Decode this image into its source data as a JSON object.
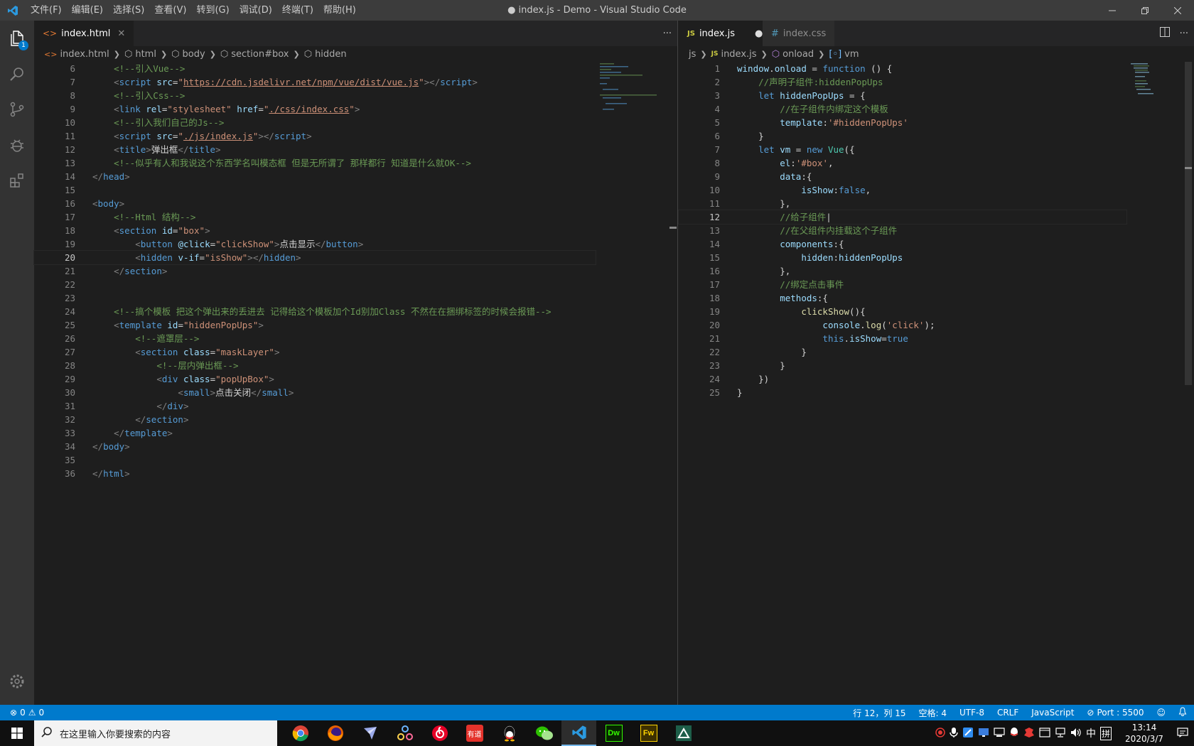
{
  "titlebar": {
    "menu": [
      "文件(F)",
      "编辑(E)",
      "选择(S)",
      "查看(V)",
      "转到(G)",
      "调试(D)",
      "终端(T)",
      "帮助(H)"
    ],
    "title": "● index.js - Demo - Visual Studio Code"
  },
  "activity": {
    "explorer_badge": "1"
  },
  "left_editor": {
    "tab_label": "index.html",
    "breadcrumbs": [
      "index.html",
      "html",
      "body",
      "section#box",
      "hidden"
    ],
    "lines": [
      {
        "n": "6",
        "html": "    <span class='cm'>&lt;!--引入Vue--&gt;</span>"
      },
      {
        "n": "7",
        "html": "    <span class='br'>&lt;</span><span class='tg'>script</span> <span class='at'>src</span><span class='tx'>=</span><span class='st'>\"<span class='ul'>https://cdn.jsdelivr.net/npm/vue/dist/vue.js</span>\"</span><span class='br'>&gt;&lt;/</span><span class='tg'>script</span><span class='br'>&gt;</span>"
      },
      {
        "n": "8",
        "html": "    <span class='cm'>&lt;!--引入Css--&gt;</span>"
      },
      {
        "n": "9",
        "html": "    <span class='br'>&lt;</span><span class='tg'>link</span> <span class='at'>rel</span><span class='tx'>=</span><span class='st'>\"stylesheet\"</span> <span class='at'>href</span><span class='tx'>=</span><span class='st'>\"<span class='ul'>./css/index.css</span>\"</span><span class='br'>&gt;</span>"
      },
      {
        "n": "10",
        "html": "    <span class='cm'>&lt;!--引入我们自己的Js--&gt;</span>"
      },
      {
        "n": "11",
        "html": "    <span class='br'>&lt;</span><span class='tg'>script</span> <span class='at'>src</span><span class='tx'>=</span><span class='st'>\"<span class='ul'>./js/index.js</span>\"</span><span class='br'>&gt;&lt;/</span><span class='tg'>script</span><span class='br'>&gt;</span>"
      },
      {
        "n": "12",
        "html": "    <span class='br'>&lt;</span><span class='tg'>title</span><span class='br'>&gt;</span><span class='tx'>弹出框</span><span class='br'>&lt;/</span><span class='tg'>title</span><span class='br'>&gt;</span>"
      },
      {
        "n": "13",
        "html": "    <span class='cm'>&lt;!--似乎有人和我说这个东西学名叫模态框 但是无所谓了 那样都行 知道是什么就OK--&gt;</span>"
      },
      {
        "n": "14",
        "html": "<span class='br'>&lt;/</span><span class='tg'>head</span><span class='br'>&gt;</span>"
      },
      {
        "n": "15",
        "html": ""
      },
      {
        "n": "16",
        "html": "<span class='br'>&lt;</span><span class='tg'>body</span><span class='br'>&gt;</span>"
      },
      {
        "n": "17",
        "html": "    <span class='cm'>&lt;!--Html 结构--&gt;</span>"
      },
      {
        "n": "18",
        "html": "    <span class='br'>&lt;</span><span class='tg'>section</span> <span class='at'>id</span><span class='tx'>=</span><span class='st'>\"box\"</span><span class='br'>&gt;</span>"
      },
      {
        "n": "19",
        "html": "        <span class='br'>&lt;</span><span class='tg'>button</span> <span class='at'>@click</span><span class='tx'>=</span><span class='st'>\"clickShow\"</span><span class='br'>&gt;</span><span class='tx'>点击显示</span><span class='br'>&lt;/</span><span class='tg'>button</span><span class='br'>&gt;</span>"
      },
      {
        "n": "20",
        "html": "        <span class='br'>&lt;</span><span class='tg'>hidden</span> <span class='at'>v-if</span><span class='tx'>=</span><span class='st'>\"isShow\"</span><span class='br'>&gt;&lt;/</span><span class='tg'>hidden</span><span class='br'>&gt;</span>",
        "current": true
      },
      {
        "n": "21",
        "html": "    <span class='br'>&lt;/</span><span class='tg'>section</span><span class='br'>&gt;</span>"
      },
      {
        "n": "22",
        "html": ""
      },
      {
        "n": "23",
        "html": ""
      },
      {
        "n": "24",
        "html": "    <span class='cm'>&lt;!--搞个模板 把这个弹出来的丢进去 记得给这个模板加个Id别加Class 不然在在捆绑标签的时候会报错--&gt;</span>"
      },
      {
        "n": "25",
        "html": "    <span class='br'>&lt;</span><span class='tg'>template</span> <span class='at'>id</span><span class='tx'>=</span><span class='st'>\"hiddenPopUps\"</span><span class='br'>&gt;</span>"
      },
      {
        "n": "26",
        "html": "        <span class='cm'>&lt;!--遮罩层--&gt;</span>"
      },
      {
        "n": "27",
        "html": "        <span class='br'>&lt;</span><span class='tg'>section</span> <span class='at'>class</span><span class='tx'>=</span><span class='st'>\"maskLayer\"</span><span class='br'>&gt;</span>"
      },
      {
        "n": "28",
        "html": "            <span class='cm'>&lt;!--层内弹出框--&gt;</span>"
      },
      {
        "n": "29",
        "html": "            <span class='br'>&lt;</span><span class='tg'>div</span> <span class='at'>class</span><span class='tx'>=</span><span class='st'>\"popUpBox\"</span><span class='br'>&gt;</span>"
      },
      {
        "n": "30",
        "html": "                <span class='br'>&lt;</span><span class='tg'>small</span><span class='br'>&gt;</span><span class='tx'>点击关闭</span><span class='br'>&lt;/</span><span class='tg'>small</span><span class='br'>&gt;</span>"
      },
      {
        "n": "31",
        "html": "            <span class='br'>&lt;/</span><span class='tg'>div</span><span class='br'>&gt;</span>"
      },
      {
        "n": "32",
        "html": "        <span class='br'>&lt;/</span><span class='tg'>section</span><span class='br'>&gt;</span>"
      },
      {
        "n": "33",
        "html": "    <span class='br'>&lt;/</span><span class='tg'>template</span><span class='br'>&gt;</span>"
      },
      {
        "n": "34",
        "html": "<span class='br'>&lt;/</span><span class='tg'>body</span><span class='br'>&gt;</span>"
      },
      {
        "n": "35",
        "html": ""
      },
      {
        "n": "36",
        "html": "<span class='br'>&lt;/</span><span class='tg'>html</span><span class='br'>&gt;</span>"
      }
    ]
  },
  "right_editor": {
    "tabs": [
      {
        "label": "index.js",
        "icon": "JS",
        "active": true,
        "modified": true
      },
      {
        "label": "index.css",
        "icon": "#",
        "active": false
      }
    ],
    "breadcrumbs": [
      "js",
      "index.js",
      "onload",
      "vm"
    ],
    "lines": [
      {
        "n": "1",
        "html": "<span class='vr'>window</span><span class='tx'>.</span><span class='vr'>onload</span><span class='tx'> = </span><span class='kw'>function</span><span class='tx'> () {</span>"
      },
      {
        "n": "2",
        "html": "    <span class='cm'>//声明子组件:hiddenPopUps</span>"
      },
      {
        "n": "3",
        "html": "    <span class='kw'>let</span> <span class='vr'>hiddenPopUps</span><span class='tx'> = {</span>"
      },
      {
        "n": "4",
        "html": "        <span class='cm'>//在子组件内绑定这个模板</span>"
      },
      {
        "n": "5",
        "html": "        <span class='vr'>template</span><span class='tx'>:</span><span class='st'>'#hiddenPopUps'</span>"
      },
      {
        "n": "6",
        "html": "    <span class='tx'>}</span>"
      },
      {
        "n": "7",
        "html": "    <span class='kw'>let</span> <span class='vr'>vm</span><span class='tx'> = </span><span class='kw'>new</span> <span class='cl'>Vue</span><span class='tx'>({</span>"
      },
      {
        "n": "8",
        "html": "        <span class='vr'>el</span><span class='tx'>:</span><span class='st'>'#box'</span><span class='tx'>,</span>"
      },
      {
        "n": "9",
        "html": "        <span class='vr'>data</span><span class='tx'>:{</span>"
      },
      {
        "n": "10",
        "html": "            <span class='vr'>isShow</span><span class='tx'>:</span><span class='kw'>false</span><span class='tx'>,</span>"
      },
      {
        "n": "11",
        "html": "        <span class='tx'>},</span>"
      },
      {
        "n": "12",
        "html": "        <span class='cm'>//给子组件</span><span class='tx'>|</span>",
        "current": true
      },
      {
        "n": "13",
        "html": "        <span class='cm'>//在父组件内挂载这个子组件</span>"
      },
      {
        "n": "14",
        "html": "        <span class='vr'>components</span><span class='tx'>:{</span>"
      },
      {
        "n": "15",
        "html": "            <span class='vr'>hidden</span><span class='tx'>:</span><span class='vr'>hiddenPopUps</span>"
      },
      {
        "n": "16",
        "html": "        <span class='tx'>},</span>"
      },
      {
        "n": "17",
        "html": "        <span class='cm'>//绑定点击事件</span>"
      },
      {
        "n": "18",
        "html": "        <span class='vr'>methods</span><span class='tx'>:{</span>"
      },
      {
        "n": "19",
        "html": "            <span class='fn'>clickShow</span><span class='tx'>(){</span>"
      },
      {
        "n": "20",
        "html": "                <span class='vr'>console</span><span class='tx'>.</span><span class='fn'>log</span><span class='tx'>(</span><span class='st'>'click'</span><span class='tx'>);</span>"
      },
      {
        "n": "21",
        "html": "                <span class='kw'>this</span><span class='tx'>.</span><span class='vr'>isShow</span><span class='tx'>=</span><span class='kw'>true</span>"
      },
      {
        "n": "22",
        "html": "            <span class='tx'>}</span>"
      },
      {
        "n": "23",
        "html": "        <span class='tx'>}</span>"
      },
      {
        "n": "24",
        "html": "    <span class='tx'>})</span>"
      },
      {
        "n": "25",
        "html": "<span class='tx'>}</span>"
      }
    ]
  },
  "status": {
    "errors": "0",
    "warnings": "0",
    "position": "行 12，列 15",
    "spaces": "空格: 4",
    "encoding": "UTF-8",
    "eol": "CRLF",
    "language": "JavaScript",
    "port": "Port : 5500"
  },
  "taskbar": {
    "search_placeholder": "在这里输入你要搜索的内容",
    "app_dw": "Dw",
    "app_fw": "Fw",
    "app_youdao": "有道",
    "ime_lang": "中",
    "ime_mode": "拼",
    "time": "13:14",
    "date": "2020/3/7"
  },
  "colors": {
    "accent": "#007acc",
    "activity_bar": "#333333",
    "titlebar": "#3c3c3c",
    "editor_bg": "#1e1e1e"
  }
}
